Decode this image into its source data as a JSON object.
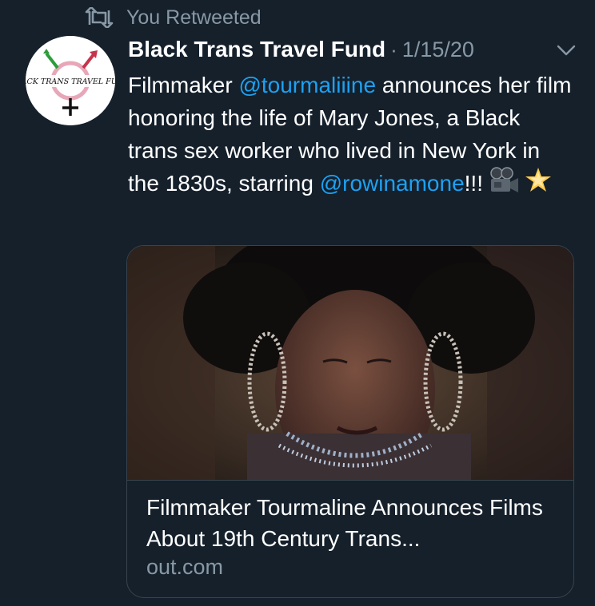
{
  "retweet": {
    "icon": "retweet-icon",
    "label": "You Retweeted"
  },
  "author": {
    "display_name": "Black Trans Travel Fund",
    "separator": "·",
    "timestamp": "1/15/20",
    "avatar_text": "BLACK TRANS TRAVEL FUND",
    "menu_icon": "chevron-down-icon"
  },
  "tweet": {
    "text_parts": [
      "Filmmaker ",
      "@tourmaliiine",
      " announces her film honoring the life of Mary Jones, a Black trans sex worker who lived in New York in the 1830s, starring ",
      "@rowinamone",
      "!!!"
    ],
    "emoji": [
      "movie-camera-emoji",
      "glowing-star-emoji"
    ]
  },
  "card": {
    "title": "Filmmaker Tourmaline Announces Films About 19th Century Trans...",
    "domain": "out.com"
  },
  "colors": {
    "background": "#15202b",
    "text": "#ffffff",
    "secondary": "#8899a6",
    "link": "#1da1f2",
    "border": "#38444d"
  }
}
